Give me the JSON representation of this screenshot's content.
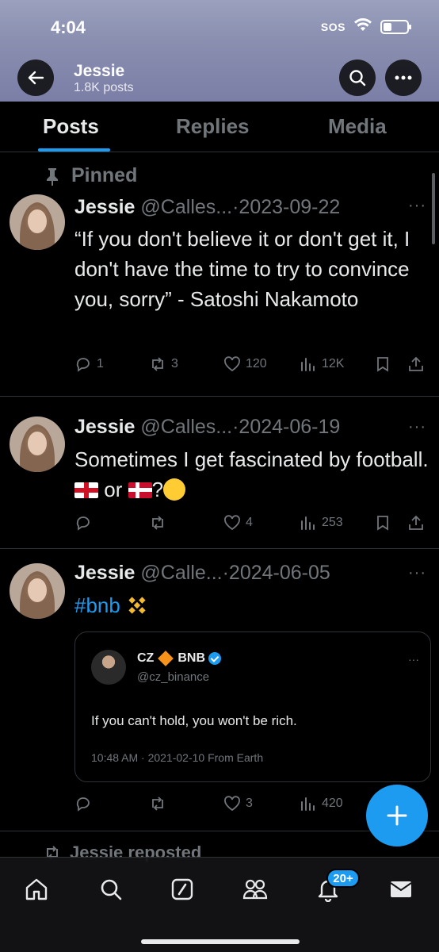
{
  "status_bar": {
    "time": "4:04",
    "sos": "SOS"
  },
  "header": {
    "name": "Jessie",
    "posts_count": "1.8K posts"
  },
  "tabs": [
    {
      "label": "Posts",
      "active": true
    },
    {
      "label": "Replies",
      "active": false
    },
    {
      "label": "Media",
      "active": false
    }
  ],
  "posts": [
    {
      "pinned_label": "Pinned",
      "name": "Jessie",
      "meta": "@Calles...·2023-09-22",
      "text": "“If you don't believe it or don't get it, I don't have the time to try to convince you, sorry” - Satoshi Nakamoto",
      "replies": "1",
      "reposts": "3",
      "likes": "120",
      "views": "12K"
    },
    {
      "name": "Jessie",
      "meta": "@Calles...·2024-06-19",
      "text_before": "Sometimes I get fascinated by football.",
      "text_or": "or",
      "text_q": "?",
      "replies": "",
      "reposts": "",
      "likes": "4",
      "views": "253"
    },
    {
      "name": "Jessie",
      "meta": "@Calle...·2024-06-05",
      "hashtag": "#bnb",
      "replies": "",
      "reposts": "",
      "likes": "3",
      "views": "420",
      "quote": {
        "name_part1": "CZ",
        "name_part2": "BNB",
        "handle": "@cz_binance",
        "text": "If you can't hold, you won't be rich.",
        "meta": "10:48 AM · 2021-02-10 From Earth"
      }
    }
  ],
  "repost_peek": "Jessie reposted",
  "notifications_badge": "20+",
  "colors": {
    "accent": "#1d9bf0",
    "muted": "#71767b",
    "text": "#e7e9ea",
    "background": "#000000"
  }
}
